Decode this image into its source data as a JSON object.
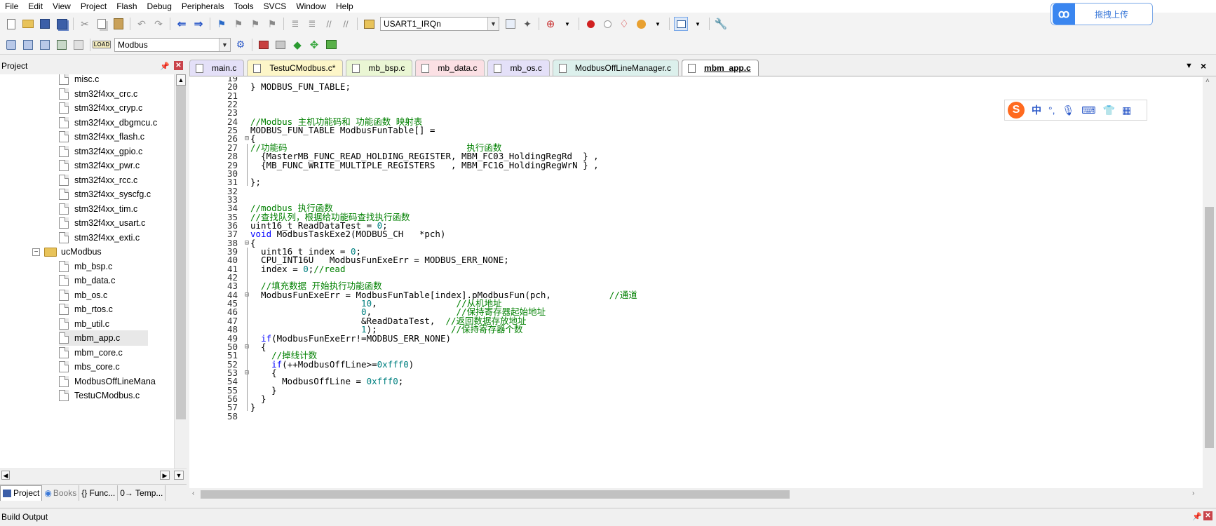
{
  "menu": [
    "File",
    "Edit",
    "View",
    "Project",
    "Flash",
    "Debug",
    "Peripherals",
    "Tools",
    "SVCS",
    "Window",
    "Help"
  ],
  "toolbar1": {
    "target_combo": "USART1_IRQn"
  },
  "toolbar2": {
    "target_combo": "Modbus"
  },
  "upload": {
    "label": "拖拽上传"
  },
  "project_panel": {
    "title": "Project",
    "files_top": [
      "misc.c",
      "stm32f4xx_crc.c",
      "stm32f4xx_cryp.c",
      "stm32f4xx_dbgmcu.c",
      "stm32f4xx_flash.c",
      "stm32f4xx_gpio.c",
      "stm32f4xx_pwr.c",
      "stm32f4xx_rcc.c",
      "stm32f4xx_syscfg.c",
      "stm32f4xx_tim.c",
      "stm32f4xx_usart.c",
      "stm32f4xx_exti.c"
    ],
    "group": "ucModbus",
    "files_group": [
      "mb_bsp.c",
      "mb_data.c",
      "mb_os.c",
      "mb_rtos.c",
      "mb_util.c",
      "mbm_app.c",
      "mbm_core.c",
      "mbs_core.c",
      "ModbusOffLineMana",
      "TestuCModbus.c"
    ],
    "selected": "mbm_app.c",
    "tabs": [
      "Project",
      "Books",
      "{} Func...",
      "0→ Temp..."
    ]
  },
  "editor": {
    "tabs": [
      {
        "label": "main.c",
        "color": "#e4e0f8"
      },
      {
        "label": "TestuCModbus.c*",
        "color": "#fdf6c8"
      },
      {
        "label": "mb_bsp.c",
        "color": "#eaf6d4"
      },
      {
        "label": "mb_data.c",
        "color": "#fbe0e4"
      },
      {
        "label": "mb_os.c",
        "color": "#e4e0f8"
      },
      {
        "label": "ModbusOffLineManager.c",
        "color": "#dcf0ec"
      },
      {
        "label": "mbm_app.c",
        "color": "#fde8c8"
      }
    ],
    "active_tab": "mbm_app.c"
  },
  "code": [
    {
      "n": "19",
      "f": "",
      "t": []
    },
    {
      "n": "20",
      "f": "",
      "t": [
        [
          "",
          "} MODBUS_FUN_TABLE;"
        ]
      ]
    },
    {
      "n": "21",
      "f": "",
      "t": []
    },
    {
      "n": "22",
      "f": "",
      "t": []
    },
    {
      "n": "23",
      "f": "",
      "t": []
    },
    {
      "n": "24",
      "f": "",
      "t": [
        [
          "cmt",
          "//Modbus 主机功能码和 功能函数 映射表"
        ]
      ]
    },
    {
      "n": "25",
      "f": "",
      "t": [
        [
          "",
          "MODBUS_FUN_TABLE ModbusFunTable[] ="
        ]
      ]
    },
    {
      "n": "26",
      "f": "⊟",
      "t": [
        [
          "",
          "{"
        ]
      ]
    },
    {
      "n": "27",
      "f": "",
      "t": [
        [
          "cmt",
          "//功能码                                  执行函数"
        ]
      ]
    },
    {
      "n": "28",
      "f": "",
      "t": [
        [
          "",
          "  {MasterMB_FUNC_READ_HOLDING_REGISTER, MBM_FC03_HoldingRegRd  } ,"
        ]
      ]
    },
    {
      "n": "29",
      "f": "",
      "t": [
        [
          "",
          "  {MB_FUNC_WRITE_MULTIPLE_REGISTERS   , MBM_FC16_HoldingRegWrN } ,"
        ]
      ]
    },
    {
      "n": "30",
      "f": "",
      "t": []
    },
    {
      "n": "31",
      "f": "",
      "t": [
        [
          "",
          "};"
        ]
      ]
    },
    {
      "n": "32",
      "f": "",
      "t": []
    },
    {
      "n": "33",
      "f": "",
      "t": []
    },
    {
      "n": "34",
      "f": "",
      "t": [
        [
          "cmt",
          "//modbus 执行函数"
        ]
      ]
    },
    {
      "n": "35",
      "f": "",
      "t": [
        [
          "cmt",
          "//查找队列，根据给功能码查找执行函数"
        ]
      ]
    },
    {
      "n": "36",
      "f": "",
      "t": [
        [
          "",
          "uint16_t ReadDataTest = "
        ],
        [
          "num",
          "0"
        ],
        [
          "",
          ";"
        ]
      ]
    },
    {
      "n": "37",
      "f": "",
      "t": [
        [
          "kw",
          "void"
        ],
        [
          "",
          " ModbusTaskExe2(MODBUS_CH   *pch)"
        ]
      ]
    },
    {
      "n": "38",
      "f": "⊟",
      "t": [
        [
          "",
          "{"
        ]
      ]
    },
    {
      "n": "39",
      "f": "",
      "t": [
        [
          "",
          "  uint16_t index = "
        ],
        [
          "num",
          "0"
        ],
        [
          "",
          ";"
        ]
      ]
    },
    {
      "n": "40",
      "f": "",
      "t": [
        [
          "",
          "  CPU_INT16U   ModbusFunExeErr = MODBUS_ERR_NONE;"
        ]
      ]
    },
    {
      "n": "41",
      "f": "",
      "t": [
        [
          "",
          "  index = "
        ],
        [
          "num",
          "0"
        ],
        [
          "",
          ";"
        ],
        [
          "cmt",
          "//read"
        ]
      ]
    },
    {
      "n": "42",
      "f": "",
      "t": []
    },
    {
      "n": "43",
      "f": "",
      "t": [
        [
          "cmt",
          "  //填充数据 开始执行功能函数"
        ]
      ]
    },
    {
      "n": "44",
      "f": "⊟",
      "t": [
        [
          "",
          "  ModbusFunExeErr = ModbusFunTable[index].pModbusFun(pch,           "
        ],
        [
          "cmt",
          "//通道"
        ]
      ]
    },
    {
      "n": "45",
      "f": "",
      "t": [
        [
          "",
          "                     "
        ],
        [
          "num",
          "10"
        ],
        [
          "",
          ",               "
        ],
        [
          "cmt",
          "//从机地址"
        ]
      ]
    },
    {
      "n": "46",
      "f": "",
      "t": [
        [
          "",
          "                     "
        ],
        [
          "num",
          "0"
        ],
        [
          "",
          ",                "
        ],
        [
          "cmt",
          "//保持寄存器起始地址"
        ]
      ]
    },
    {
      "n": "47",
      "f": "",
      "t": [
        [
          "",
          "                     &ReadDataTest,  "
        ],
        [
          "cmt",
          "//返回数据存放地址"
        ]
      ]
    },
    {
      "n": "48",
      "f": "",
      "t": [
        [
          "",
          "                     "
        ],
        [
          "num",
          "1"
        ],
        [
          "",
          ");              "
        ],
        [
          "cmt",
          "//保持寄存器个数"
        ]
      ]
    },
    {
      "n": "49",
      "f": "",
      "t": [
        [
          "",
          "  "
        ],
        [
          "kw",
          "if"
        ],
        [
          "",
          "(ModbusFunExeErr!=MODBUS_ERR_NONE)"
        ]
      ]
    },
    {
      "n": "50",
      "f": "⊟",
      "t": [
        [
          "",
          "  {"
        ]
      ]
    },
    {
      "n": "51",
      "f": "",
      "t": [
        [
          "cmt",
          "    //掉线计数"
        ]
      ]
    },
    {
      "n": "52",
      "f": "",
      "t": [
        [
          "",
          "    "
        ],
        [
          "kw",
          "if"
        ],
        [
          "",
          "(++ModbusOffLine>="
        ],
        [
          "num",
          "0xfff0"
        ],
        [
          "",
          ")"
        ]
      ]
    },
    {
      "n": "53",
      "f": "⊟",
      "t": [
        [
          "",
          "    {"
        ]
      ]
    },
    {
      "n": "54",
      "f": "",
      "t": [
        [
          "",
          "      ModbusOffLine = "
        ],
        [
          "num",
          "0xfff0"
        ],
        [
          "",
          ";"
        ]
      ]
    },
    {
      "n": "55",
      "f": "",
      "t": [
        [
          "",
          "    }"
        ]
      ]
    },
    {
      "n": "56",
      "f": "",
      "t": [
        [
          "",
          "  }"
        ]
      ]
    },
    {
      "n": "57",
      "f": "",
      "t": [
        [
          "",
          "}"
        ]
      ]
    },
    {
      "n": "58",
      "f": "",
      "t": []
    }
  ],
  "build": {
    "title": "Build Output"
  },
  "ime": {
    "logo": "S",
    "mode": "中"
  }
}
